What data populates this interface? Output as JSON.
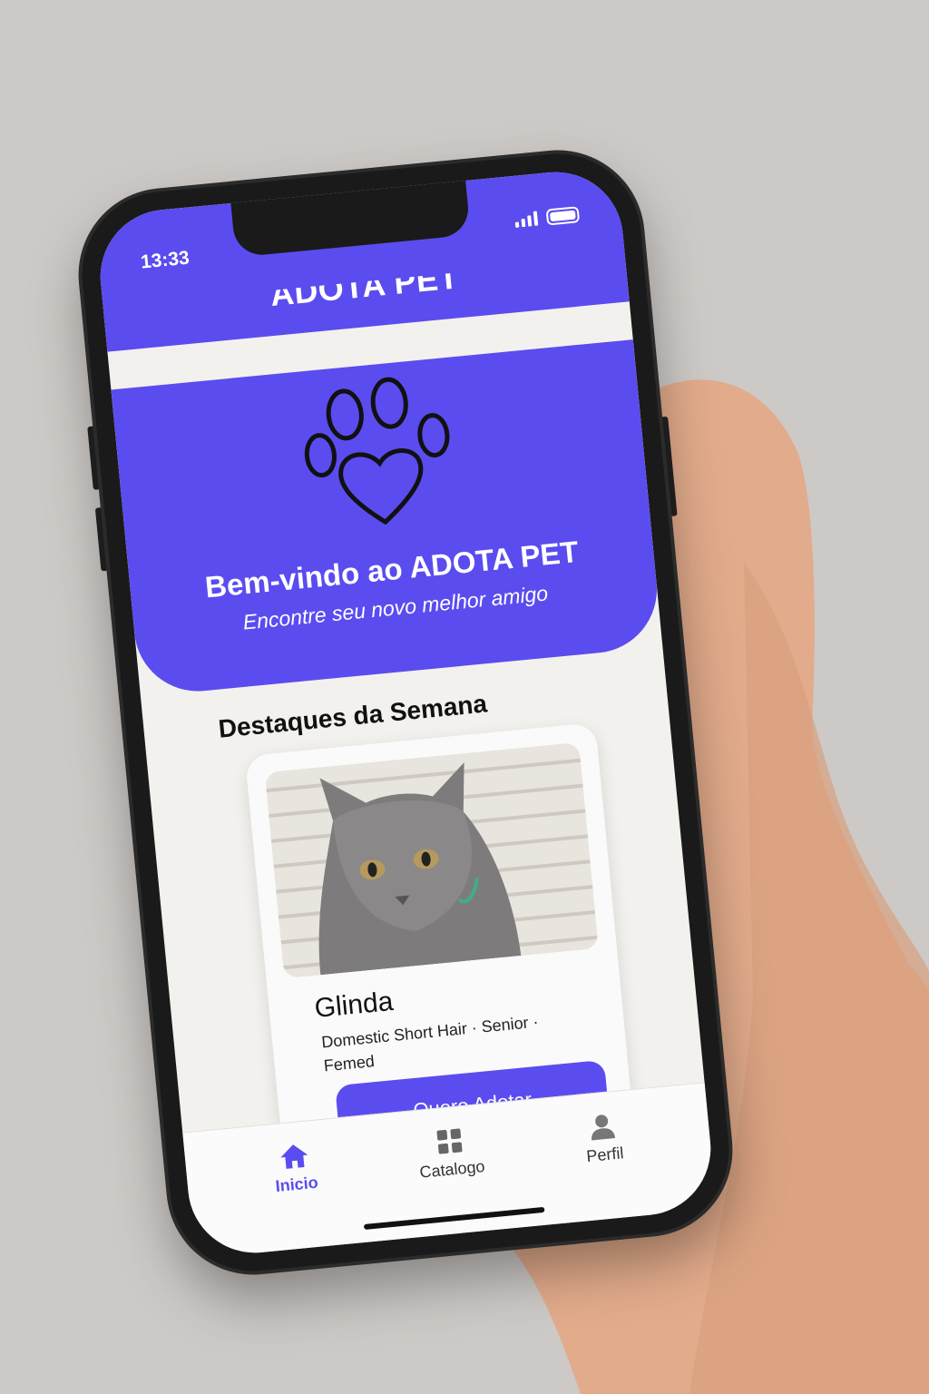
{
  "status_bar": {
    "time": "13:33",
    "signal_icon": "signal-bars-icon",
    "battery_icon": "battery-icon"
  },
  "header": {
    "title": "ADOTA PET"
  },
  "hero": {
    "icon": "paw-heart-icon",
    "title": "Bem-vindo ao ADOTA PET",
    "subtitle": "Encontre seu novo melhor amigo"
  },
  "featured": {
    "section_title": "Destaques da Semana",
    "card": {
      "photo": "gray-cat-photo",
      "name": "Glinda",
      "meta": "Domestic Short Hair · Senior · Femed",
      "button_label": "Quero Adotar"
    }
  },
  "tabbar": {
    "tabs": [
      {
        "label": "Inicio",
        "icon": "home-icon",
        "active": true
      },
      {
        "label": "Catalogo",
        "icon": "grid-icon",
        "active": false
      },
      {
        "label": "Perfil",
        "icon": "person-icon",
        "active": false
      }
    ]
  },
  "colors": {
    "accent": "#5b4cf0",
    "background": "#f3f1ee",
    "surface": "#cdc9c6"
  }
}
